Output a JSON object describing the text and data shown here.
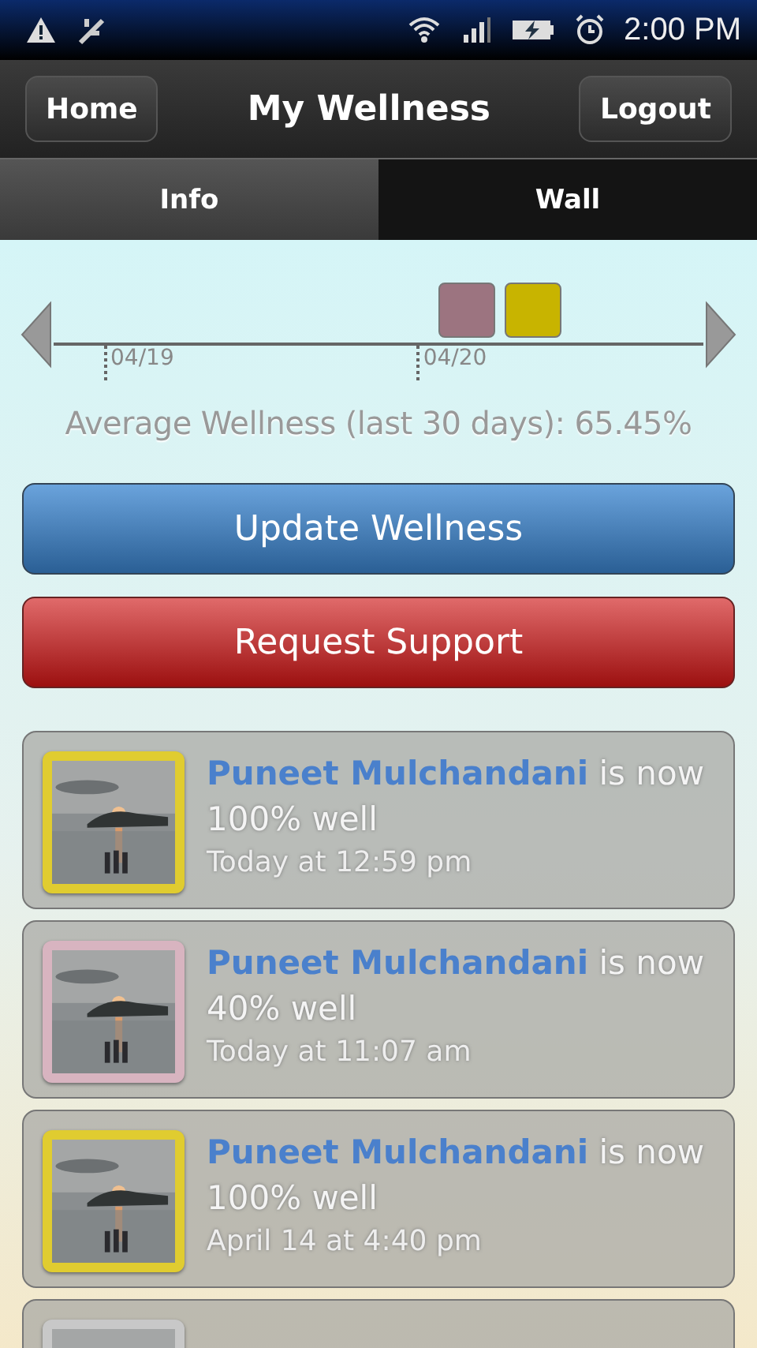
{
  "status_bar": {
    "time": "2:00 PM"
  },
  "header": {
    "title": "My Wellness",
    "left_button": "Home",
    "right_button": "Logout"
  },
  "tabs": [
    {
      "label": "Info",
      "selected": true
    },
    {
      "label": "Wall",
      "selected": false
    }
  ],
  "timeline": {
    "markers": [
      {
        "color": "#9c7480"
      },
      {
        "color": "#c8b400"
      }
    ],
    "dates": [
      "04/19",
      "04/20"
    ]
  },
  "average": "Average Wellness (last 30 days): 65.45%",
  "buttons": [
    {
      "label": "Update Wellness",
      "kind": "primary"
    },
    {
      "label": "Request Support",
      "kind": "danger"
    }
  ],
  "posts": [
    {
      "name": "Puneet Mulchandani",
      "text": "is now 100% well",
      "time": "Today at 12:59 pm",
      "color": "#e0cc30"
    },
    {
      "name": "Puneet Mulchandani",
      "text": "is now 40% well",
      "time": "Today at 11:07 am",
      "color": "#d8b4c0"
    },
    {
      "name": "Puneet Mulchandani",
      "text": "is now 100% well",
      "time": "April 14 at 4:40 pm",
      "color": "#e0cc30"
    },
    {
      "color": "#c8c8c8"
    }
  ]
}
